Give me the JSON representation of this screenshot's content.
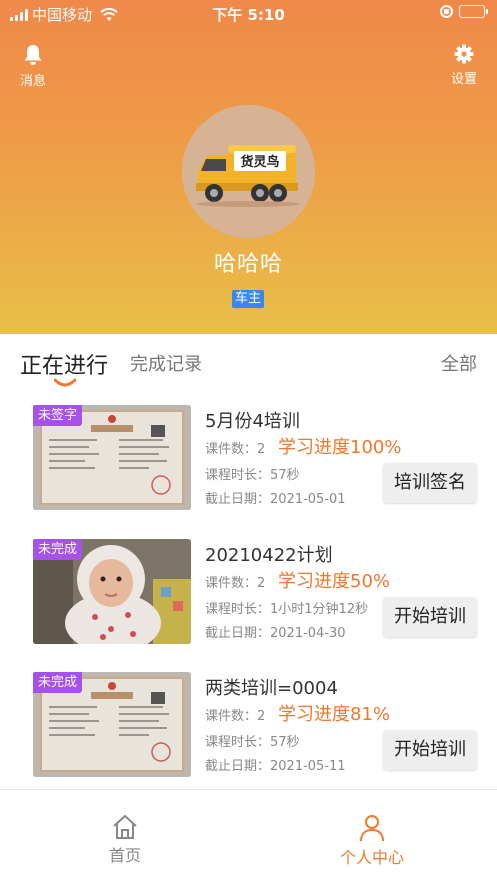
{
  "status_bar": {
    "carrier": "中国移动",
    "time": "下午 5:10"
  },
  "header": {
    "messages_label": "消息",
    "settings_label": "设置",
    "avatar_text": "货灵鸟",
    "username": "哈哈哈",
    "role": "车主"
  },
  "tabs": {
    "active": "正在进行",
    "done": "完成记录",
    "all": "全部"
  },
  "labels": {
    "courses": "课件数：",
    "duration": "课程时长：",
    "deadline": "截止日期："
  },
  "trainings": [
    {
      "status_tag": "未签字",
      "title": "5月份4培训",
      "course_count": "2",
      "progress": "学习进度100%",
      "duration": "57秒",
      "deadline": "2021-05-01",
      "action": "培训签名"
    },
    {
      "status_tag": "未完成",
      "title": "20210422计划",
      "course_count": "2",
      "progress": "学习进度50%",
      "duration": "1小时1分钟12秒",
      "deadline": "2021-04-30",
      "action": "开始培训"
    },
    {
      "status_tag": "未完成",
      "title": "两类培训=0004",
      "course_count": "2",
      "progress": "学习进度81%",
      "duration": "57秒",
      "deadline": "2021-05-11",
      "action": "开始培训"
    }
  ],
  "bottom_nav": {
    "home": "首页",
    "me": "个人中心"
  },
  "colors": {
    "accent": "#f0782d",
    "tag": "#a652e6",
    "role_badge": "#3b86f0"
  }
}
